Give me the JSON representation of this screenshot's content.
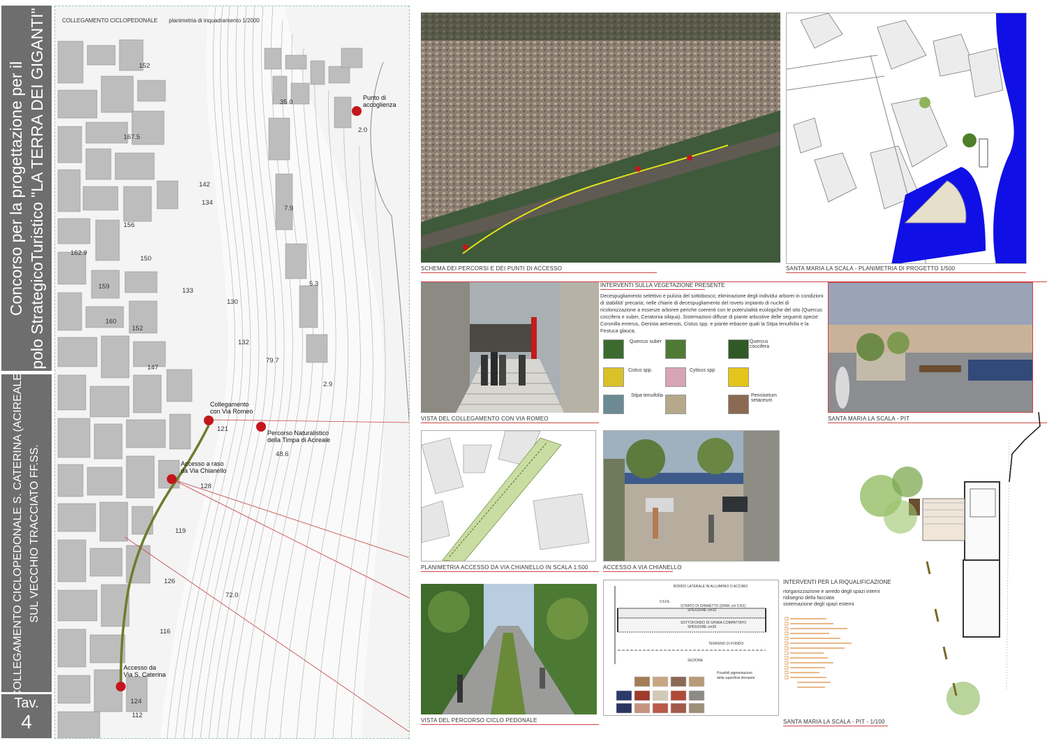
{
  "sidebar": {
    "title_line1": "Concorso per la progettazione per il",
    "title_line2": "polo StrategicoTuristico \"LA TERRA DEI GIGANTI\"",
    "subtitle_line1": "COLLEGAMENTO CICLOPEDONALE S. CATERINA (ACIREALE)",
    "subtitle_line2": "SUL VECCHIO TRACCIATO FF.SS.",
    "tav_label": "Tav.",
    "tav_number": "4"
  },
  "map": {
    "heading": "COLLEGAMENTO CICLOPEDONALE",
    "subheading": "planimetria di inquadramento 1/2000",
    "points": {
      "accoglienza_1": "Punto di",
      "accoglienza_2": "accoglienza",
      "romeo_1": "Collegamento",
      "romeo_2": "con Via Romeo",
      "naturalistico_1": "Percorso Naturalistico",
      "naturalistico_2": "della Timpa di Acireale",
      "chianello_1": "Accesso a raso",
      "chianello_2": "da Via Chianello",
      "caterina_1": "Accesso da",
      "caterina_2": "Via S. Caterina"
    },
    "elevations": [
      "152",
      "35.0",
      "2.0",
      "167.5",
      "142",
      "134",
      "7.9",
      "156",
      "162.9",
      "150",
      "5.3",
      "159",
      "133",
      "130",
      "160",
      "152",
      "132",
      "147",
      "79.7",
      "2.9",
      "121",
      "48.6",
      "128",
      "119",
      "126",
      "72.0",
      "116",
      "124",
      "112"
    ]
  },
  "panels": {
    "schema_caption": "SCHEMA DEI PERCORSI E DEI PUNTI DI ACCESSO",
    "scala_plan_caption": "SANTA MARIA LA SCALA - PLANIMETRIA DI PROGETTO 1/500",
    "romeo_caption": "VISTA DEL COLLEGAMENTO CON VIA ROMEO",
    "scala_pit_caption": "SANTA MARIA LA SCALA - PIT",
    "chianello_plan_caption": "PLANIMETRIA ACCESSO DA VIA CHIANELLO  in scala 1:500",
    "chianello_photo_caption": "ACCESSO A VIA CHIANELLO",
    "percorso_caption": "VISTA DEL PERCORSO CICLO PEDONALE",
    "pit_plan_caption": "SANTA MARIA LA SCALA - PIT - 1/100"
  },
  "vegetation": {
    "title": "INTERVENTI SULLA VEGETAZIONE PRESENTE",
    "text": "Decespugliamento selettivo e pulizia del sottobosco; eliminazione degli individui arborei in condizioni di stabilitá' precaria; nelle chiarie di decespugliamento del roveto impianto di nuclei di ricolonizzazione a essenze arboree periche coerenti con le potenzialitá ecologiche del sito (Quercus coccifera e suber, Ceratonia siliqua). Sistemazioni diffuse di piante arbustive delle seguenti specie: Coronilla emerus, Genista aetnensis, Cistus spp. e piante erbacee quali la Stipa tenuifolia e la Festuca glauca.",
    "plants": [
      "Quercus suber",
      "Quercus coccifera",
      "Cistus spp.",
      "Cytisus spp",
      "Stipa tenuifolia",
      "Pennisetum setaceum"
    ]
  },
  "riqualificazione": {
    "title": "INTERVENTI PER LA RIQUALIFICAZIONE",
    "line1": "riorganizzazione e arredo degli spazi interni",
    "line2": "ridisegno della facciata",
    "line3": "sistemazione degli spazi esterni"
  },
  "section": {
    "bordo": "BORDO LATERALE IN ALLUMINIO O ACCIAIO",
    "slope": "0.51%",
    "strato": "STRATO DI GHIAIETTO (DIAM. cm 0.5/1)",
    "spessore": "SPESSORE cm10",
    "sottofondo": "SOTTOFONDO DI GHIAIA COMPATTATO",
    "spessore2": "SPESSORE cm30",
    "terreno": "TERRENO DI FONDO",
    "sezione": "SEZIONE",
    "pigment_1": "Possibili pigmentazioni",
    "pigment_2": "della superficie drenante"
  },
  "colors": {
    "sidebar_bg": "#6e6e6e",
    "pin_red": "#c4161c",
    "path_green": "#6b7d2c",
    "sea_blue": "#1010e6",
    "leader_red": "#c44444"
  }
}
